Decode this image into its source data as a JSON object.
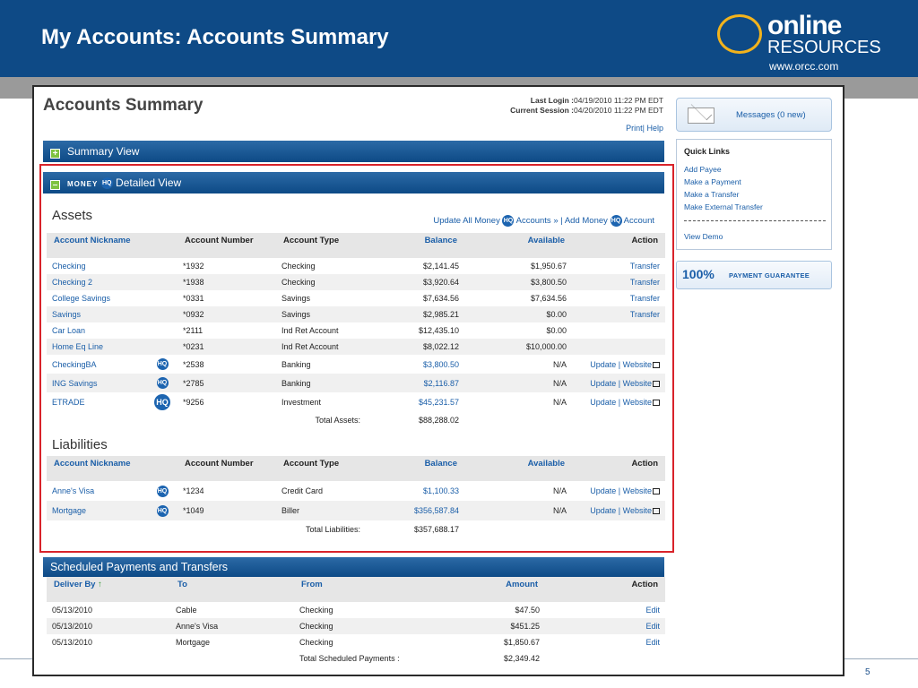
{
  "slide": {
    "title": "My Accounts: Accounts Summary",
    "logo_online": "online",
    "logo_resources": "RESOURCES",
    "logo_url": "www.orcc.com",
    "page_number": "5"
  },
  "page": {
    "heading": "Accounts Summary",
    "last_login_label": "Last Login :",
    "last_login_value": "04/19/2010 11:22 PM EDT",
    "current_session_label": "Current Session :",
    "current_session_value": "04/20/2010 11:22 PM EDT",
    "print_label": "Print",
    "help_label": "Help"
  },
  "summary_view": {
    "label": "Summary View",
    "icon": "plus-icon"
  },
  "detailed_view": {
    "label": "Detailed View",
    "money_word": "MONEY",
    "hq": "HQ",
    "icon": "minus-icon"
  },
  "assets": {
    "title": "Assets",
    "update_all_prefix": "Update All Money",
    "update_all_suffix": "Accounts »",
    "add_prefix": "Add Money",
    "add_suffix": "Account",
    "headers": [
      "Account Nickname",
      "Account Number",
      "Account Type",
      "Balance",
      "Available",
      "Action"
    ],
    "rows": [
      {
        "nickname": "Checking",
        "hq": "",
        "number": "*1932",
        "type": "Checking",
        "balance": "$2,141.45",
        "balance_blue": false,
        "available": "$1,950.67",
        "action": "Transfer",
        "action_type": "transfer"
      },
      {
        "nickname": "Checking 2",
        "hq": "",
        "number": "*1938",
        "type": "Checking",
        "balance": "$3,920.64",
        "balance_blue": false,
        "available": "$3,800.50",
        "action": "Transfer",
        "action_type": "transfer"
      },
      {
        "nickname": "College Savings",
        "hq": "",
        "number": "*0331",
        "type": "Savings",
        "balance": "$7,634.56",
        "balance_blue": false,
        "available": "$7,634.56",
        "action": "Transfer",
        "action_type": "transfer"
      },
      {
        "nickname": "Savings",
        "hq": "",
        "number": "*0932",
        "type": "Savings",
        "balance": "$2,985.21",
        "balance_blue": false,
        "available": "$0.00",
        "action": "Transfer",
        "action_type": "transfer"
      },
      {
        "nickname": "Car Loan",
        "hq": "",
        "number": "*2111",
        "type": "Ind Ret Account",
        "balance": "$12,435.10",
        "balance_blue": false,
        "available": "$0.00",
        "action": "",
        "action_type": "none"
      },
      {
        "nickname": "Home Eq Line",
        "hq": "",
        "number": "*0231",
        "type": "Ind Ret Account",
        "balance": "$8,022.12",
        "balance_blue": false,
        "available": "$10,000.00",
        "action": "",
        "action_type": "none"
      },
      {
        "nickname": "CheckingBA",
        "hq": "HQ",
        "number": "*2538",
        "type": "Banking",
        "balance": "$3,800.50",
        "balance_blue": true,
        "available": "N/A",
        "action": "Update | Website",
        "action_type": "update"
      },
      {
        "nickname": "ING Savings",
        "hq": "HQ",
        "number": "*2785",
        "type": "Banking",
        "balance": "$2,116.87",
        "balance_blue": true,
        "available": "N/A",
        "action": "Update | Website",
        "action_type": "update"
      },
      {
        "nickname": "ETRADE",
        "hq": "HQ",
        "number": "*9256",
        "type": "Investment",
        "balance": "$45,231.57",
        "balance_blue": true,
        "available": "N/A",
        "action": "Update | Website",
        "action_type": "update"
      }
    ],
    "total_label": "Total Assets:",
    "total_value": "$88,288.02"
  },
  "liabilities": {
    "title": "Liabilities",
    "headers": [
      "Account Nickname",
      "Account Number",
      "Account Type",
      "Balance",
      "Available",
      "Action"
    ],
    "rows": [
      {
        "nickname": "Anne's Visa",
        "hq": "HQ",
        "number": "*1234",
        "type": "Credit Card",
        "balance": "$1,100.33",
        "available": "N/A",
        "action": "Update | Website"
      },
      {
        "nickname": "Mortgage",
        "hq": "HQ",
        "number": "*1049",
        "type": "Biller",
        "balance": "$356,587.84",
        "available": "N/A",
        "action": "Update | Website"
      }
    ],
    "total_label": "Total Liabilities:",
    "total_value": "$357,688.17"
  },
  "scheduled": {
    "title": "Scheduled Payments and Transfers",
    "headers": [
      "Deliver By",
      "To",
      "From",
      "Amount",
      "Action"
    ],
    "sort_arrow": "↑",
    "rows": [
      {
        "date": "05/13/2010",
        "to": "Cable",
        "from": "Checking",
        "amount": "$47.50",
        "action": "Edit"
      },
      {
        "date": "05/13/2010",
        "to": "Anne's Visa",
        "from": "Checking",
        "amount": "$451.25",
        "action": "Edit"
      },
      {
        "date": "05/13/2010",
        "to": "Mortgage",
        "from": "Checking",
        "amount": "$1,850.67",
        "action": "Edit"
      }
    ],
    "total_label": "Total Scheduled Payments :",
    "total_value": "$2,349.42"
  },
  "sidebar": {
    "messages_label": "Messages (0 new)",
    "quick_links_title": "Quick Links",
    "quick_links": [
      "Add Payee",
      "Make a Payment",
      "Make a Transfer",
      "Make External Transfer"
    ],
    "view_demo": "View Demo",
    "guarantee_pct": "100%",
    "guarantee_text": "PAYMENT GUARANTEE"
  }
}
